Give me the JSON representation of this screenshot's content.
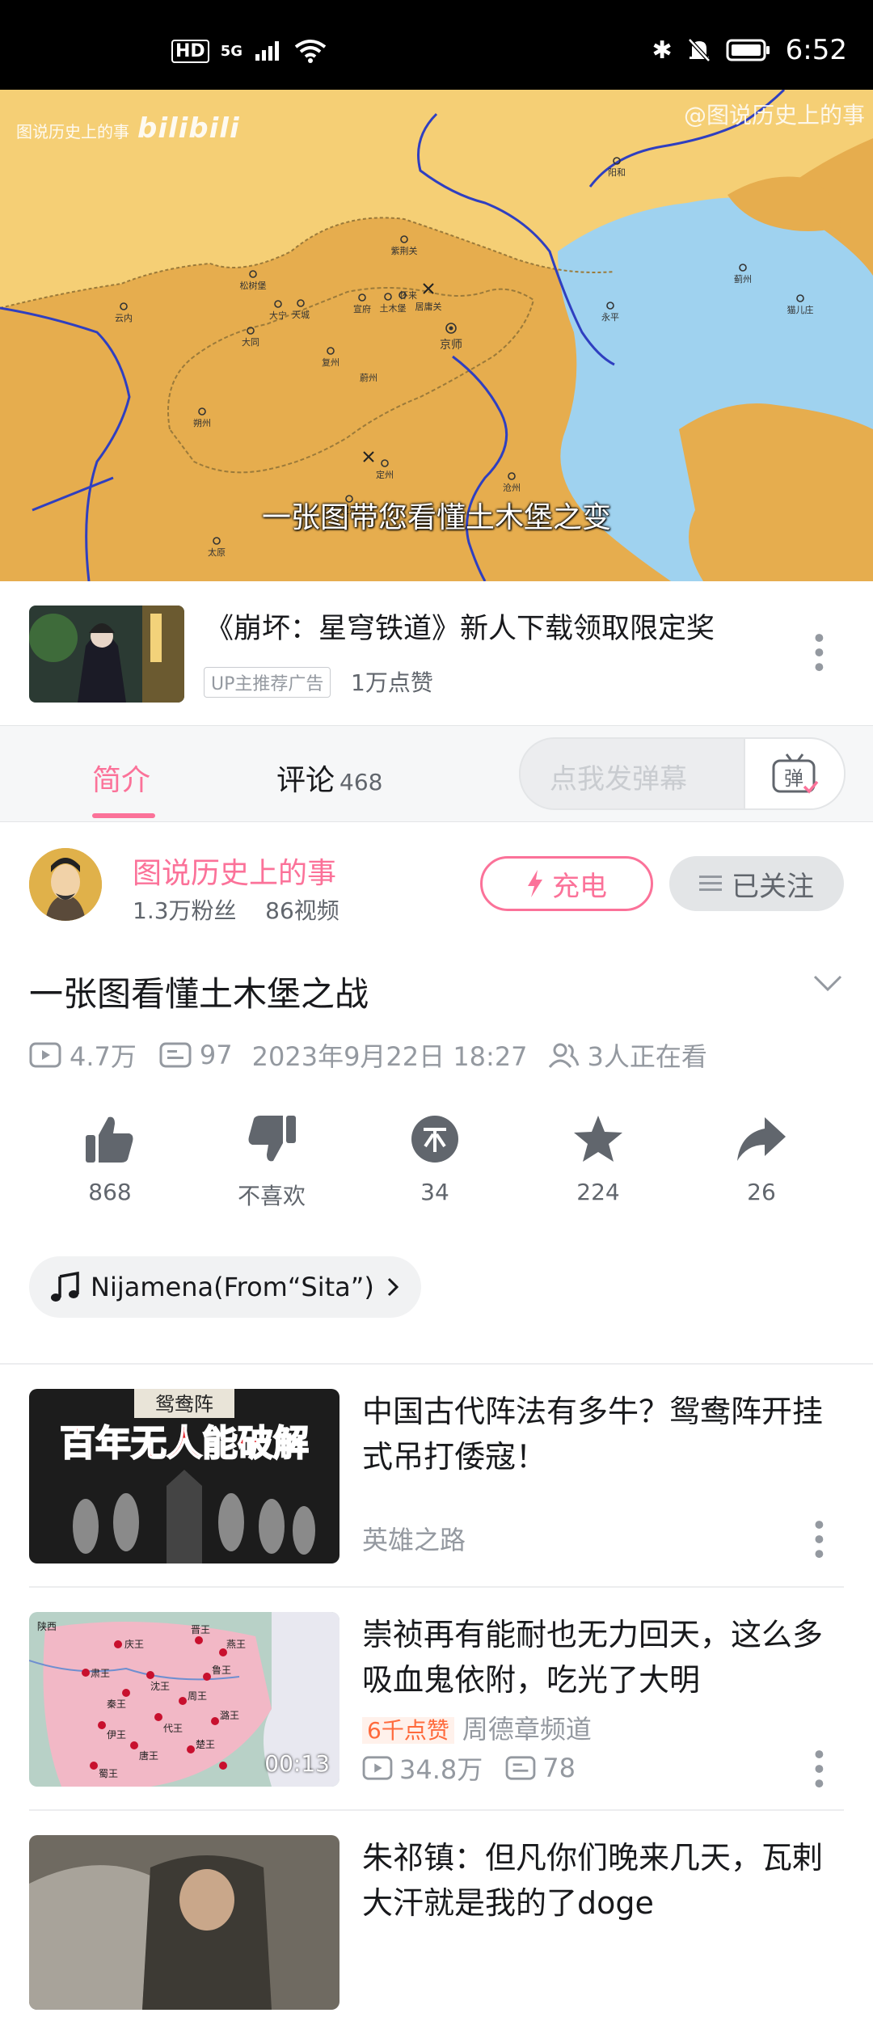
{
  "status_bar": {
    "left_labels": [
      "HD",
      "5G"
    ],
    "time": "6:52"
  },
  "player": {
    "watermark_left": "图说历史上的事",
    "watermark_left_brand": "bilibili",
    "watermark_right": "@图说历史上的事",
    "subtitle": "一张图带您看懂土木堡之变",
    "map_labels": [
      "京师",
      "土木堡",
      "大同",
      "宣府",
      "云内",
      "怀来",
      "居庸关",
      "朔州",
      "太原",
      "定州",
      "沧州",
      "蓟州",
      "永平",
      "大宁",
      "阳和",
      "猫儿庄",
      "天城",
      "松树堡",
      "紫荆关",
      "蔚州",
      "复州"
    ]
  },
  "ad": {
    "title": "《崩坏：星穹铁道》新人下载领取限定奖",
    "badge": "UP主推荐广告",
    "likes": "1万点赞"
  },
  "tabs": {
    "intro": "简介",
    "comments": "评论",
    "comments_count": "468",
    "danmaku_placeholder": "点我发弹幕",
    "danmaku_btn": "弹"
  },
  "uploader": {
    "name": "图说历史上的事",
    "fans": "1.3万粉丝",
    "videos": "86视频",
    "charge": "充电",
    "follow": "已关注"
  },
  "video": {
    "title": "一张图看懂土木堡之战",
    "views": "4.7万",
    "danmaku": "97",
    "date": "2023年9月22日 18:27",
    "watching": "3人正在看"
  },
  "actions": [
    {
      "icon": "thumbs-up-icon",
      "label": "868"
    },
    {
      "icon": "thumbs-down-icon",
      "label": "不喜欢"
    },
    {
      "icon": "coin-icon",
      "label": "34"
    },
    {
      "icon": "star-icon",
      "label": "224"
    },
    {
      "icon": "share-icon",
      "label": "26"
    }
  ],
  "music": {
    "label": "Nijamena(From“Sita”)"
  },
  "recommendations": [
    {
      "title": "中国古代阵法有多牛？鸳鸯阵开挂式吊打倭寇！",
      "author": "英雄之路",
      "thumb_top_text": "鸳鸯阵",
      "thumb_text": "百年无人能破解"
    },
    {
      "title": "崇祯再有能耐也无力回天，这么多吸血鬼依附，吃光了大明",
      "hot": "6千点赞",
      "author": "周德章频道",
      "views": "34.8万",
      "danmaku": "78",
      "duration": "00:13",
      "thumb_labels": [
        "陕西",
        "庆王",
        "晋王",
        "燕王",
        "肃王",
        "安王",
        "沈王",
        "鲁王",
        "韩王",
        "秦王",
        "周王",
        "代王",
        "伊王",
        "唐王",
        "楚王",
        "潞王",
        "崇王",
        "瑞王",
        "福王",
        "蜀王",
        "岷王",
        "沔王",
        "赵王",
        "德王",
        "荣王"
      ]
    },
    {
      "title": "朱祁镇：但凡你们晚来几天，瓦剌大汗就是我的了doge"
    }
  ],
  "colors": {
    "brand_pink": "#fb7299",
    "map_land": "#e6ad4e",
    "map_north": "#f5cf75",
    "sea": "#9fd2ef",
    "river": "#2f3fc0"
  }
}
